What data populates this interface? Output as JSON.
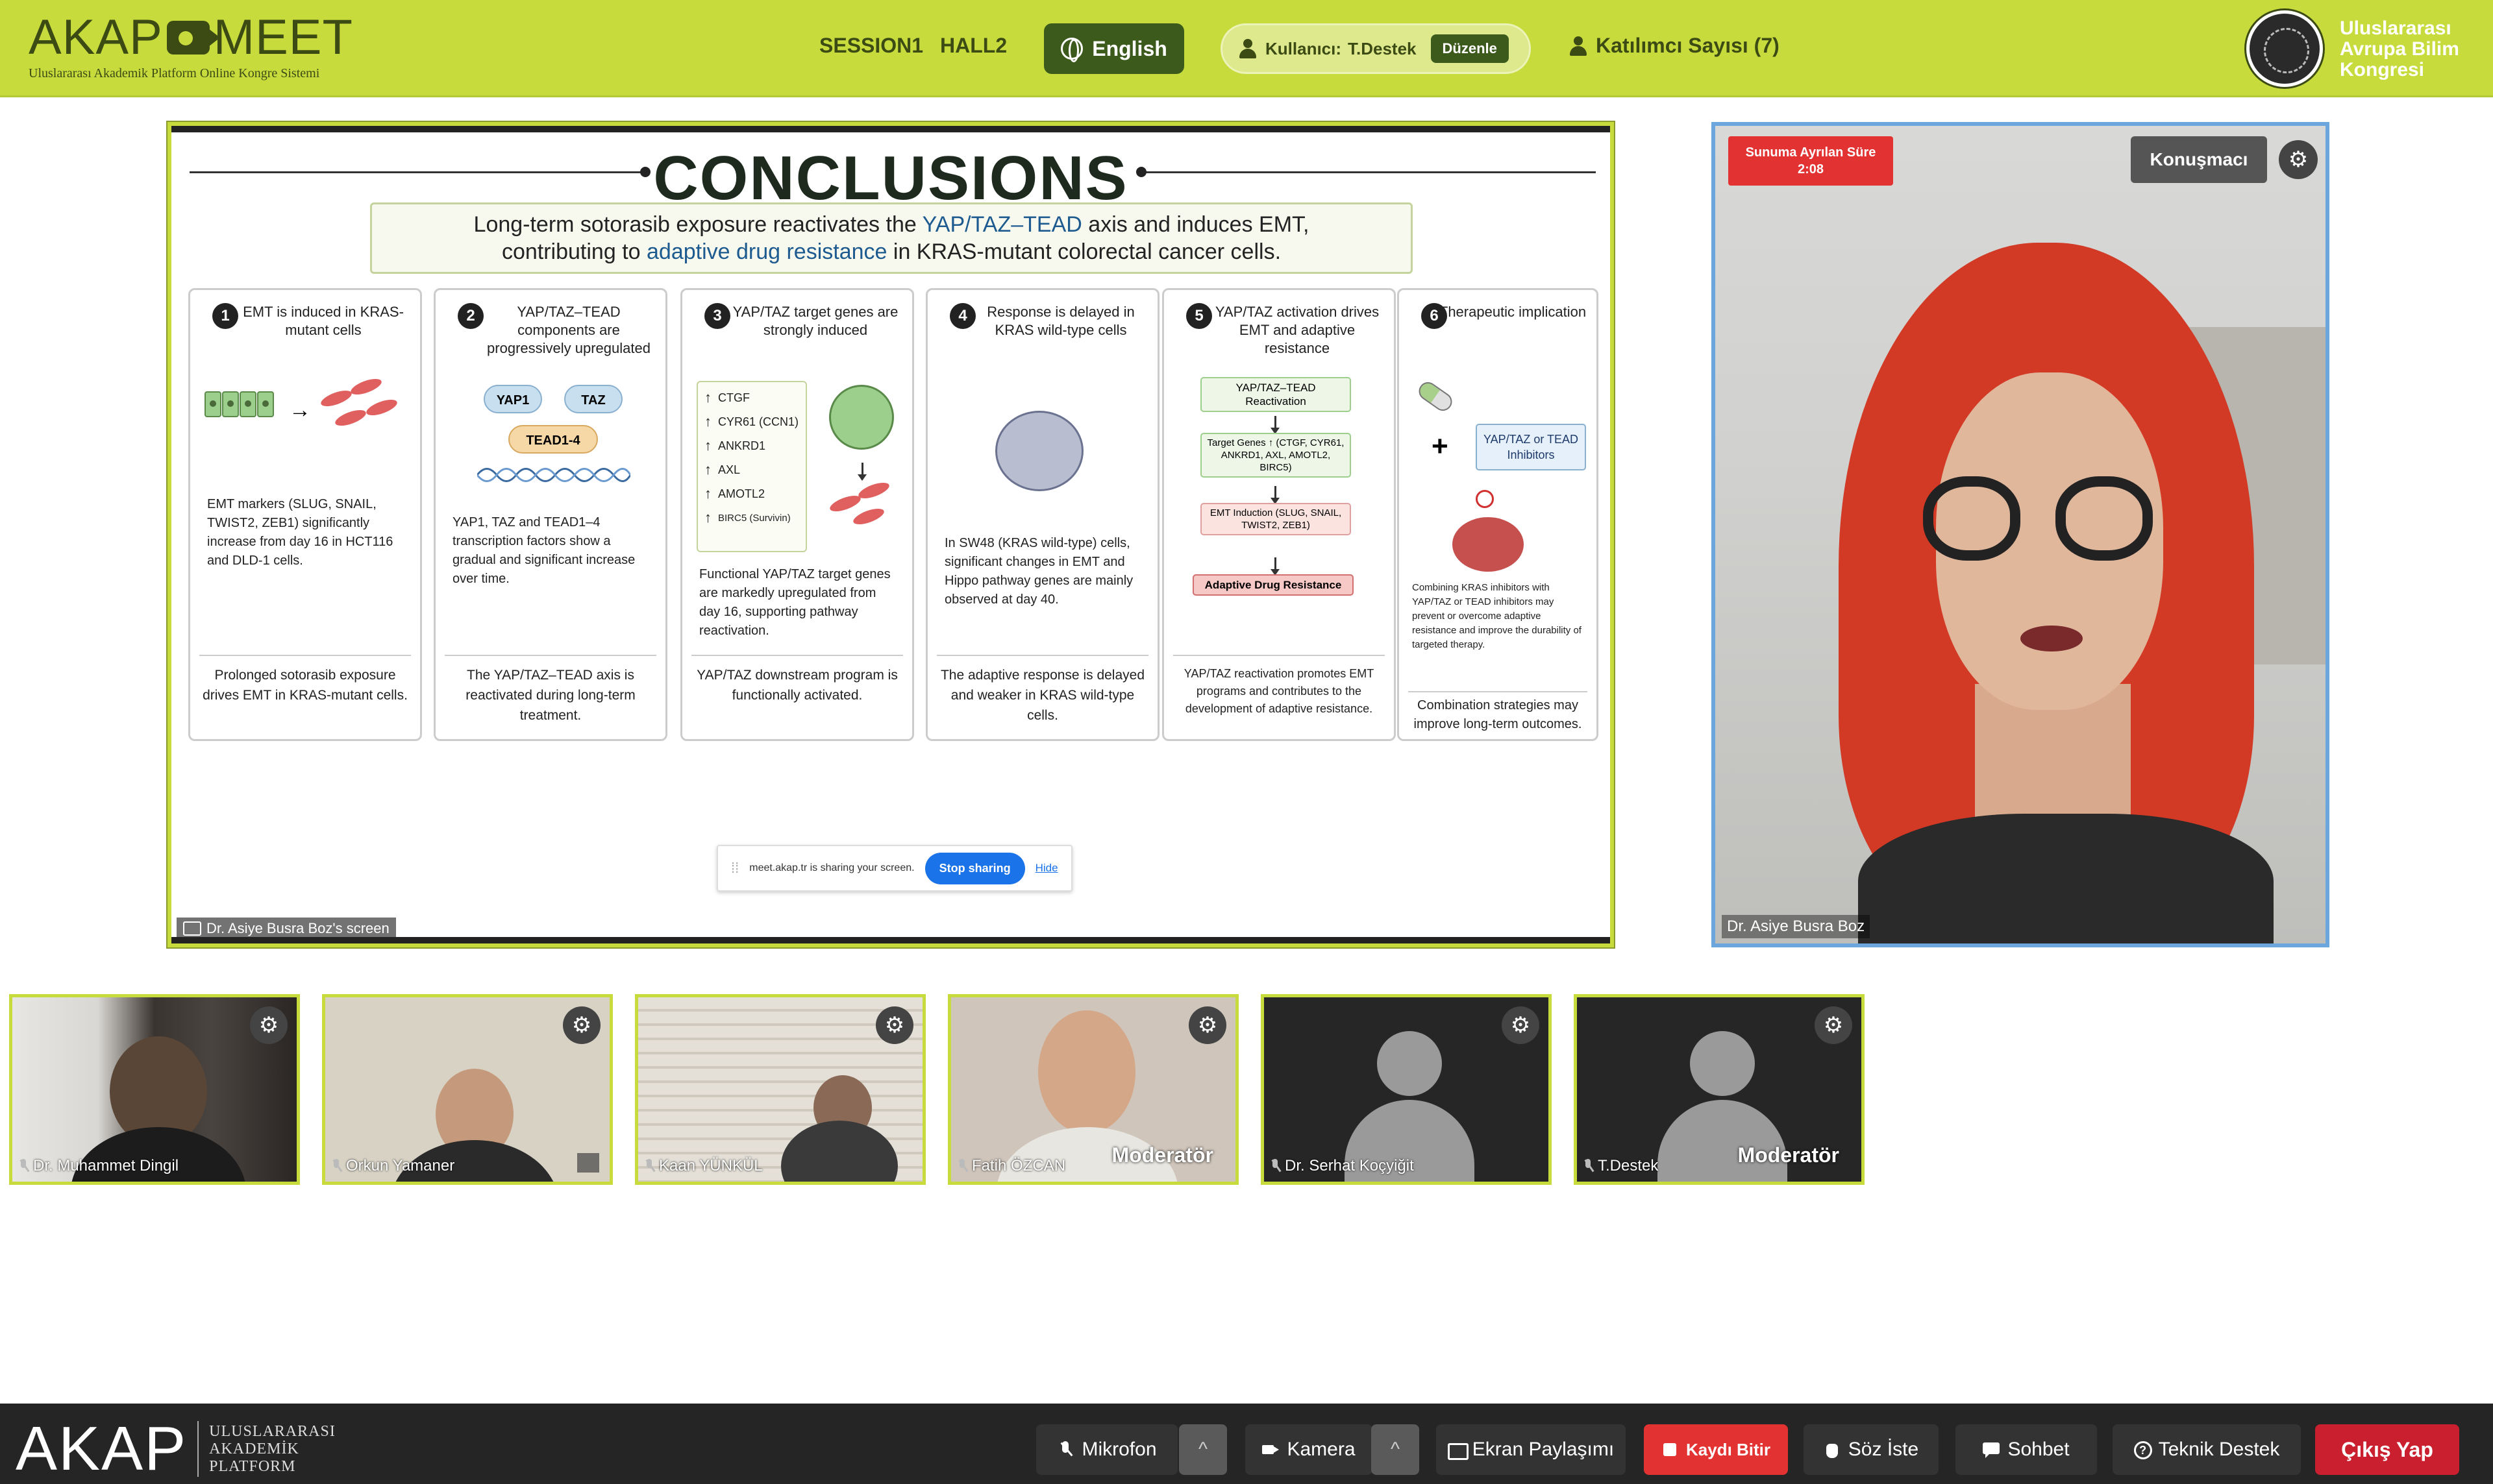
{
  "header": {
    "logo_text_left": "AKAP",
    "logo_text_right": "MEET",
    "logo_subtitle": "Uluslararası Akademik Platform Online Kongre Sistemi",
    "session": "SESSION1",
    "hall": "HALL2",
    "language": "English",
    "user_label": "Kullanıcı:",
    "user_name": "T.Destek",
    "edit_label": "Düzenle",
    "participants": "Katılımcı Sayısı (7)",
    "congress_line1": "Uluslararası",
    "congress_line2": "Avrupa Bilim",
    "congress_line3": "Kongresi"
  },
  "slide": {
    "title": "CONCLUSIONS",
    "lead_part1": "Long-term sotorasib exposure reactivates the ",
    "lead_hl1": "YAP/TAZ–TEAD",
    "lead_part2": " axis and induces EMT,",
    "lead_part3": "contributing to ",
    "lead_hl2": "adaptive drug resistance",
    "lead_part4": " in KRAS-mutant colorectal cancer cells.",
    "cards": [
      {
        "num": "1",
        "title": "EMT is induced in KRAS-mutant cells",
        "desc": "EMT markers (SLUG, SNAIL, TWIST2, ZEB1) significantly increase from day 16 in HCT116 and DLD-1 cells.",
        "foot": "Prolonged sotorasib exposure drives EMT in KRAS-mutant cells."
      },
      {
        "num": "2",
        "title": "YAP/TAZ–TEAD components are progressively upregulated",
        "yap": "YAP1",
        "taz": "TAZ",
        "tead": "TEAD1-4",
        "desc": "YAP1, TAZ and TEAD1–4 transcription factors show a gradual and significant increase over time.",
        "foot": "The YAP/TAZ–TEAD axis is reactivated during long-term treatment."
      },
      {
        "num": "3",
        "title": "YAP/TAZ target genes are strongly induced",
        "genes": [
          "CTGF",
          "CYR61 (CCN1)",
          "ANKRD1",
          "AXL",
          "AMOTL2",
          "BIRC5 (Survivin)"
        ],
        "desc": "Functional YAP/TAZ target genes are markedly upregulated from day 16, supporting pathway reactivation.",
        "foot": "YAP/TAZ downstream program is functionally activated."
      },
      {
        "num": "4",
        "title": "Response is delayed in KRAS wild-type cells",
        "desc": "In SW48 (KRAS wild-type) cells, significant changes in EMT and Hippo pathway genes are mainly observed at day 40.",
        "foot": "The adaptive response is delayed and weaker in KRAS wild-type cells."
      },
      {
        "num": "5",
        "title": "YAP/TAZ activation drives EMT and adaptive resistance",
        "flow1": "YAP/TAZ–TEAD Reactivation",
        "flow2": "Target Genes ↑ (CTGF, CYR61, ANKRD1, AXL, AMOTL2, BIRC5)",
        "flow3": "EMT Induction (SLUG, SNAIL, TWIST2, ZEB1)",
        "flow4": "Adaptive Drug Resistance",
        "foot": "YAP/TAZ reactivation promotes EMT programs and contributes to the development of adaptive resistance."
      },
      {
        "num": "6",
        "title": "Therapeutic implication",
        "inhib": "YAP/TAZ or TEAD Inhibitors",
        "desc": "Combining KRAS inhibitors with YAP/TAZ or TEAD inhibitors may prevent or overcome adaptive resistance and improve the durability of targeted therapy.",
        "foot": "Combination strategies may improve long-term outcomes."
      }
    ],
    "share_text": "meet.akap.tr is sharing your screen.",
    "stop_sharing": "Stop sharing",
    "hide": "Hide",
    "screen_label": "Dr. Asiye Busra Boz's screen"
  },
  "speaker": {
    "timer_label": "Sunuma Ayrılan Süre",
    "timer_value": "2:08",
    "role": "Konuşmacı",
    "name": "Dr. Asiye Busra Boz"
  },
  "participants": [
    {
      "name": "Dr. Muhammet Dingil",
      "moderator": ""
    },
    {
      "name": "Orkun Yamaner",
      "moderator": ""
    },
    {
      "name": "Kaan YÜNKÜL",
      "moderator": ""
    },
    {
      "name": "Fatih ÖZCAN",
      "moderator": "Moderatör"
    },
    {
      "name": "Dr. Serhat Koçyiğit",
      "moderator": ""
    },
    {
      "name": "T.Destek",
      "moderator": "Moderatör"
    }
  ],
  "bottombar": {
    "logo": "AKAP",
    "logo_sub1": "ULUSLARARASI",
    "logo_sub2": "AKADEMİK",
    "logo_sub3": "PLATFORM",
    "mic": "Mikrofon",
    "caret": "^",
    "camera": "Kamera",
    "share": "Ekran Paylaşımı",
    "record": "Kaydı Bitir",
    "raise": "Söz İste",
    "chat": "Sohbet",
    "support": "Teknik Destek",
    "exit": "Çıkış Yap"
  },
  "colors": {
    "brand_green": "#c7dc3c",
    "dark_green": "#3c5a1c",
    "danger_red": "#e33232"
  }
}
